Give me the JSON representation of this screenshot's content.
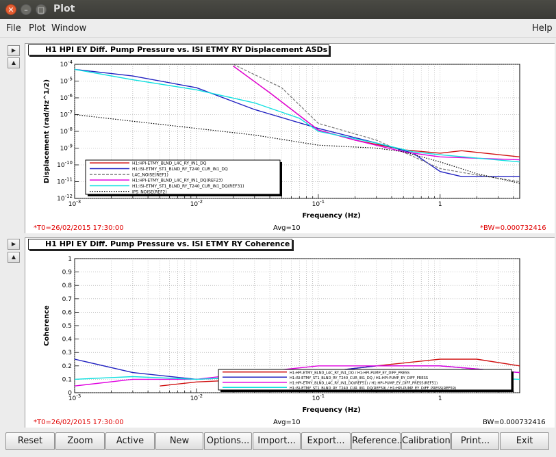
{
  "window": {
    "title": "Plot",
    "close_glyph": "✕",
    "min_glyph": "–",
    "max_glyph": "□"
  },
  "menu": {
    "file": "File",
    "plot": "Plot",
    "window": "Window",
    "help": "Help"
  },
  "arrows": {
    "right": "▶",
    "up": "▲"
  },
  "panel1": {
    "title": "H1 HPI EY Diff. Pump Pressure vs. ISI ETMY RY Displacement ASDs",
    "t0": "*T0=26/02/2015 17:30:00",
    "avg": "Avg=10",
    "bw": "*BW=0.000732416"
  },
  "panel2": {
    "title": "H1 HPI EY Diff. Pump Pressure vs. ISI ETMY RY Coherence",
    "t0": "*T0=26/02/2015 17:30:00",
    "avg": "Avg=10",
    "bw": "BW=0.000732416"
  },
  "buttons": [
    "Reset",
    "Zoom",
    "Active",
    "New",
    "Options...",
    "Import...",
    "Export...",
    "Reference...",
    "Calibration...",
    "Print...",
    "Exit"
  ],
  "chart_data": [
    {
      "type": "line",
      "title": "H1 HPI EY Diff. Pump Pressure vs. ISI ETMY RY Displacement ASDs",
      "xlabel": "Frequency (Hz)",
      "ylabel": "Displacement (rad/Hz^1/2)",
      "xscale": "log",
      "yscale": "log",
      "xlim": [
        0.001,
        4.5
      ],
      "ylim": [
        1e-12,
        0.0001
      ],
      "x_ticks": [
        "10-3",
        "10-2",
        "10-1",
        "1"
      ],
      "y_ticks": [
        "10-12",
        "10-11",
        "10-10",
        "10-9",
        "10-8",
        "10-7",
        "10-6",
        "10-5",
        "10-4"
      ],
      "grid": true,
      "legend_position": "bottom-left",
      "series": [
        {
          "name": "H1:HPI-ETMY_BLND_L4C_RY_IN1_DQ",
          "color": "#d01010",
          "style": "solid",
          "x": [
            0.02,
            0.04,
            0.1,
            0.2,
            0.5,
            1,
            1.5,
            4.5
          ],
          "y": [
            8e-05,
            2e-06,
            1.2e-08,
            3e-09,
            8e-10,
            5e-10,
            7e-10,
            3e-10
          ]
        },
        {
          "name": "H1:ISI-ETMY_ST1_BLND_RY_T240_CUR_IN1_DQ",
          "color": "#2020c0",
          "style": "solid",
          "x": [
            0.001,
            0.003,
            0.01,
            0.03,
            0.1,
            0.3,
            0.6,
            1,
            1.5,
            4.5
          ],
          "y": [
            5e-05,
            2e-05,
            4e-06,
            2e-07,
            1.5e-08,
            2e-09,
            5e-10,
            4e-11,
            2e-11,
            2e-11
          ]
        },
        {
          "name": "L4C_NOISE(REF1)",
          "color": "#777777",
          "style": "dashed",
          "x": [
            0.02,
            0.05,
            0.1,
            0.3,
            1,
            2,
            4.5
          ],
          "y": [
            0.0001,
            4e-06,
            3e-08,
            3e-09,
            6e-11,
            2.5e-11,
            1e-11
          ]
        },
        {
          "name": "H1:HPI-ETMY_BLND_L4C_RY_IN1_DQ(REF23)",
          "color": "#e000e0",
          "style": "solid",
          "x": [
            0.02,
            0.04,
            0.1,
            0.2,
            0.5,
            1,
            2,
            4.5
          ],
          "y": [
            8e-05,
            2e-06,
            1.2e-08,
            3e-09,
            6e-10,
            3e-10,
            2.5e-10,
            2e-10
          ]
        },
        {
          "name": "H1:ISI-ETMY_ST1_BLND_RY_T240_CUR_IN1_DQ(REF31)",
          "color": "#10e0e0",
          "style": "solid",
          "x": [
            0.001,
            0.003,
            0.01,
            0.03,
            0.07,
            0.1,
            0.3,
            0.6,
            1,
            4.5
          ],
          "y": [
            5e-05,
            1.2e-05,
            3e-06,
            5e-07,
            6e-08,
            1e-08,
            2e-09,
            6e-10,
            4e-10,
            1.5e-10
          ]
        },
        {
          "name": "IPS_NOISE(REF2)",
          "color": "#000000",
          "style": "dotted",
          "x": [
            0.001,
            0.003,
            0.01,
            0.03,
            0.1,
            0.3,
            0.5,
            1,
            2,
            4.5
          ],
          "y": [
            1e-07,
            4e-08,
            1.5e-08,
            6e-09,
            1.5e-09,
            1e-09,
            6e-10,
            1.5e-10,
            3e-11,
            8e-12
          ]
        }
      ]
    },
    {
      "type": "line",
      "title": "H1 HPI EY Diff. Pump Pressure vs. ISI ETMY RY Coherence",
      "xlabel": "Frequency (Hz)",
      "ylabel": "Coherence",
      "xscale": "log",
      "xlim": [
        0.001,
        4.5
      ],
      "ylim": [
        0,
        1
      ],
      "x_ticks": [
        "10-3",
        "10-2",
        "10-1",
        "1"
      ],
      "y_ticks": [
        "0",
        "0.1",
        "0.2",
        "0.3",
        "0.4",
        "0.5",
        "0.6",
        "0.7",
        "0.8",
        "0.9",
        "1"
      ],
      "grid": true,
      "legend_position": "bottom-right",
      "series": [
        {
          "name": "H1:HPI-ETMY_BLND_L4C_RY_IN1_DQ / H1:HPI-PUMP_EY_DIFF_PRESS",
          "color": "#d01010",
          "style": "solid",
          "x": [
            0.005,
            0.01,
            0.03,
            0.1,
            0.3,
            1,
            2,
            4.5
          ],
          "y": [
            0.05,
            0.08,
            0.1,
            0.15,
            0.2,
            0.25,
            0.25,
            0.2
          ]
        },
        {
          "name": "H1:ISI-ETMY_ST1_BLND_RY_T240_CUR_IN1_DQ / H1:HPI-PUMP_EY_DIFF_PRESS",
          "color": "#2020c0",
          "style": "solid",
          "x": [
            0.001,
            0.003,
            0.01,
            0.03,
            0.1,
            0.3,
            1,
            4.5
          ],
          "y": [
            0.25,
            0.15,
            0.1,
            0.12,
            0.15,
            0.2,
            0.2,
            0.15
          ]
        },
        {
          "name": "H1:HPI-ETMY_BLND_L4C_RY_IN1_DQ(REF51) / H1:HPI-PUMP_EY_DIFF_PRESS(REF51)",
          "color": "#e000e0",
          "style": "solid",
          "x": [
            0.001,
            0.003,
            0.01,
            0.03,
            0.1,
            0.3,
            1,
            4.5
          ],
          "y": [
            0.05,
            0.1,
            0.1,
            0.15,
            0.2,
            0.2,
            0.2,
            0.15
          ]
        },
        {
          "name": "H1:ISI-ETMY_ST1_BLND_RY_T240_CUR_IN1_DQ(REF59) / H1:HPI-PUMP_EY_DIFF_PRESS(REF59)",
          "color": "#10e0e0",
          "style": "solid",
          "x": [
            0.001,
            0.003,
            0.01,
            0.03,
            0.1,
            0.3,
            1,
            4.5
          ],
          "y": [
            0.1,
            0.12,
            0.1,
            0.12,
            0.15,
            0.15,
            0.12,
            0.1
          ]
        }
      ]
    }
  ]
}
